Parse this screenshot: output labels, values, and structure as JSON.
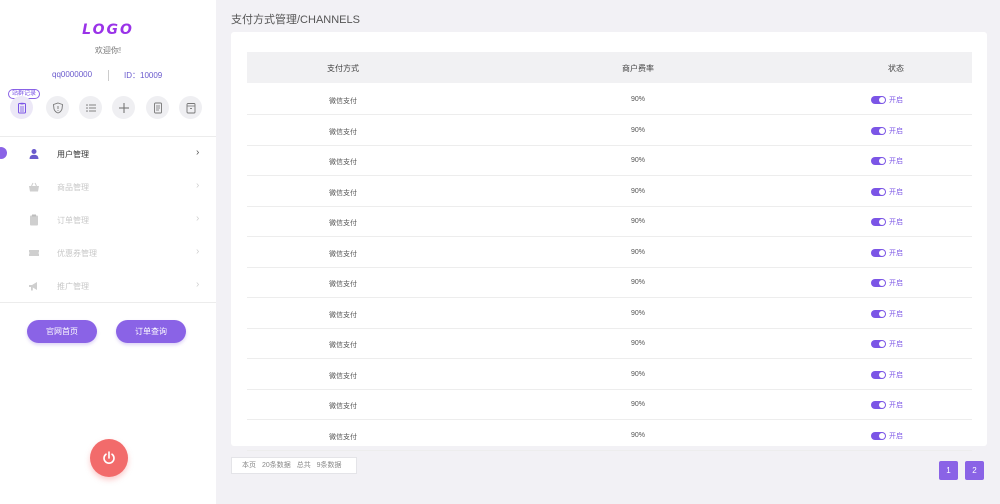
{
  "sidebar": {
    "logo": "LOGO",
    "welcome": "欢迎你!",
    "user_name": "qq0000000",
    "user_id": "ID：10009",
    "tooltip": "站群记录",
    "menu": [
      {
        "label": "用户管理",
        "icon": "user-icon",
        "active": true
      },
      {
        "label": "商品管理",
        "icon": "basket-icon",
        "active": false
      },
      {
        "label": "订单管理",
        "icon": "clipboard-icon",
        "active": false
      },
      {
        "label": "优惠券管理",
        "icon": "ticket-icon",
        "active": false
      },
      {
        "label": "推广管理",
        "icon": "megaphone-icon",
        "active": false
      }
    ],
    "btn_home": "官网首页",
    "btn_order_query": "订单查询"
  },
  "page_title": "支付方式管理/CHANNELS",
  "table": {
    "headers": [
      "支付方式",
      "商户费率",
      "状态"
    ],
    "rows": [
      {
        "method": "微信支付",
        "rate": "90%",
        "status": "开启"
      },
      {
        "method": "微信支付",
        "rate": "90%",
        "status": "开启"
      },
      {
        "method": "微信支付",
        "rate": "90%",
        "status": "开启"
      },
      {
        "method": "微信支付",
        "rate": "90%",
        "status": "开启"
      },
      {
        "method": "微信支付",
        "rate": "90%",
        "status": "开启"
      },
      {
        "method": "微信支付",
        "rate": "90%",
        "status": "开启"
      },
      {
        "method": "微信支付",
        "rate": "90%",
        "status": "开启"
      },
      {
        "method": "微信支付",
        "rate": "90%",
        "status": "开启"
      },
      {
        "method": "微信支付",
        "rate": "90%",
        "status": "开启"
      },
      {
        "method": "微信支付",
        "rate": "90%",
        "status": "开启"
      },
      {
        "method": "微信支付",
        "rate": "90%",
        "status": "开启"
      },
      {
        "method": "微信支付",
        "rate": "90%",
        "status": "开启"
      }
    ]
  },
  "footer": {
    "this_page": "本页",
    "page_count": "20条数据",
    "total_label": "总共",
    "total_count": "9条数据"
  },
  "pagination": [
    "1",
    "2"
  ],
  "colors": {
    "accent": "#8a63e6",
    "logo": "#9a33e8",
    "power": "#f26b6b"
  }
}
